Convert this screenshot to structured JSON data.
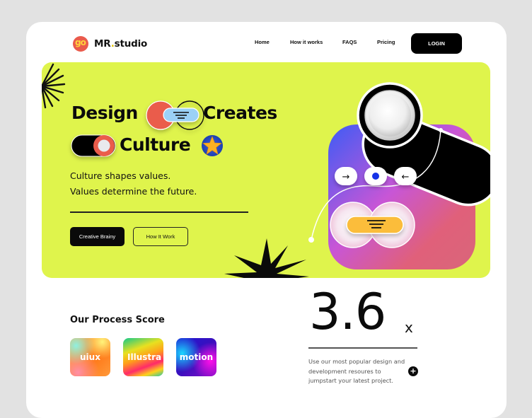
{
  "brand": {
    "name_prefix": "MR",
    "name_dot": ".",
    "name_suffix": "studio",
    "logo_glyph": "go",
    "logo_color": "#ea5b4c"
  },
  "nav": {
    "items": [
      {
        "label": "Home"
      },
      {
        "label": "How it works"
      },
      {
        "label": "FAQS"
      },
      {
        "label": "Pricing"
      }
    ],
    "login_label": "LOGIN"
  },
  "hero": {
    "background_color": "#dff44c",
    "headline_line1_a": "Design",
    "headline_line1_b": "Creates",
    "headline_line2": "Culture",
    "subtitle_line1": "Culture shapes values.",
    "subtitle_line2": "Values determine the future.",
    "primary_button": "Creative Brainy",
    "secondary_button": "How It Work",
    "graphic_controls": {
      "left_arrow": "→",
      "right_arrow": "←"
    }
  },
  "process": {
    "title": "Our Process Score",
    "tiles": [
      {
        "label": "uiux"
      },
      {
        "label": "Illustra"
      },
      {
        "label": "motion"
      }
    ]
  },
  "score": {
    "value": "3.6",
    "suffix": "x",
    "description": "Use our most popular design and development resoures to jumpstart your latest project.",
    "plus_icon": "+"
  }
}
